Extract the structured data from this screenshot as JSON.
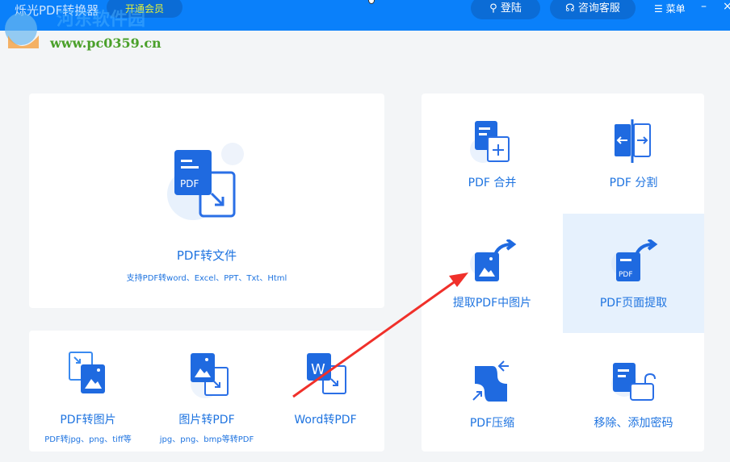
{
  "app": {
    "title": "烁光PDF转换器",
    "vip": "开通会员",
    "login": "登陆",
    "support": "咨询客服",
    "menu": "菜单",
    "minimize": "–",
    "close": "×"
  },
  "watermark": {
    "name": "河东软件园",
    "url": "www.pc0359.cn"
  },
  "main": {
    "title": "PDF转文件",
    "desc": "支持PDF转word、Excel、PPT、Txt、Html"
  },
  "convert": [
    {
      "label": "PDF转图片",
      "desc": "PDF转jpg、png、tiff等"
    },
    {
      "label": "图片转PDF",
      "desc": "jpg、png、bmp等转PDF"
    },
    {
      "label": "Word转PDF",
      "desc": ""
    }
  ],
  "tools": [
    {
      "label": "PDF 合并"
    },
    {
      "label": "PDF 分割"
    },
    {
      "label": "提取PDF中图片"
    },
    {
      "label": "PDF页面提取"
    },
    {
      "label": "PDF压缩"
    },
    {
      "label": "移除、添加密码"
    }
  ],
  "colors": {
    "brand": "#0a80fa",
    "accent": "#1f74e0",
    "annotation": "#f0302a"
  }
}
